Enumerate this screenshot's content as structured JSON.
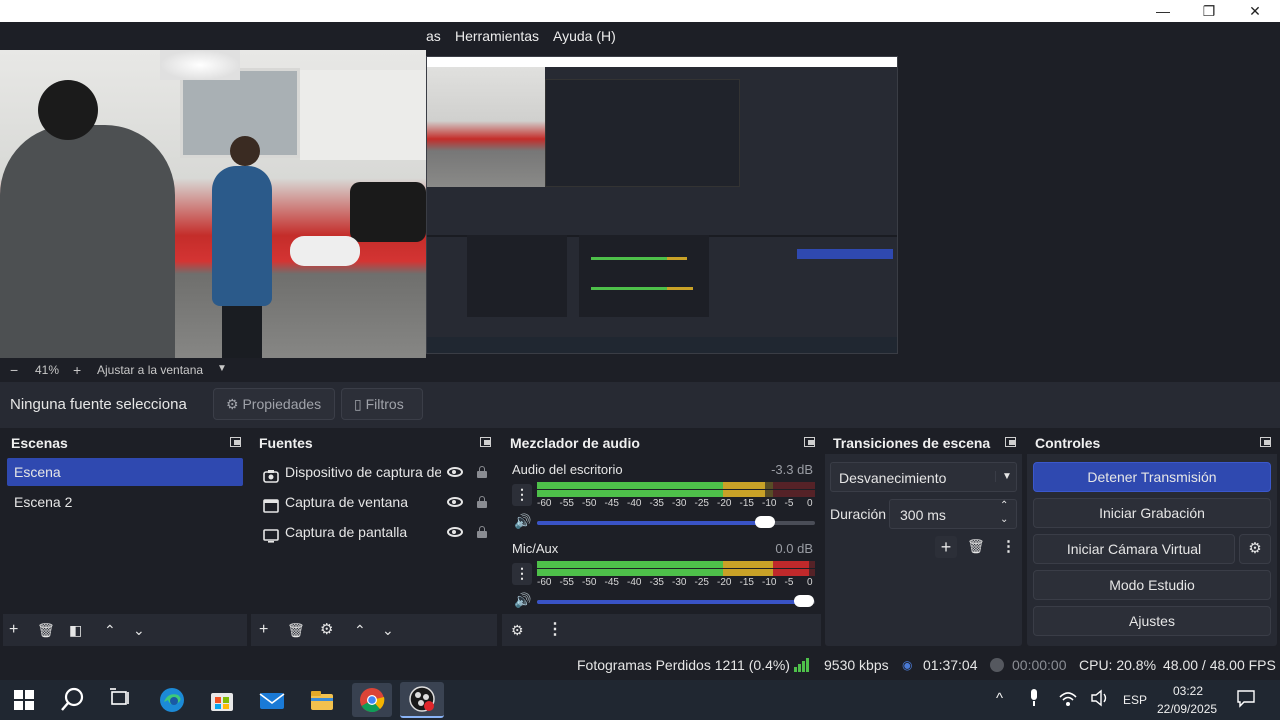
{
  "menu": {
    "items": [
      "as",
      "Herramientas",
      "Ayuda (H)"
    ]
  },
  "window_controls": {
    "minimize": "—",
    "restore": "❐",
    "close": "✕"
  },
  "zoom": {
    "minus": "−",
    "value": "41%",
    "plus": "+",
    "fit_label": "Ajustar a la ventana",
    "dropdown": "▼"
  },
  "properties_bar": {
    "no_source": "Ninguna fuente selecciona",
    "properties_label": "Propiedades",
    "filters_label": "Filtros"
  },
  "scenes": {
    "title": "Escenas",
    "items": [
      "Escena",
      "Escena 2"
    ]
  },
  "sources": {
    "title": "Fuentes",
    "items": [
      "Dispositivo de captura de",
      "Captura de ventana",
      "Captura de pantalla"
    ]
  },
  "mixer": {
    "title": "Mezclador de audio",
    "channels": [
      {
        "name": "Audio del escritorio",
        "db": "-3.3 dB",
        "level_fraction": 0.82,
        "volume_fraction": 0.82
      },
      {
        "name": "Mic/Aux",
        "db": "0.0 dB",
        "level_fraction": 0.98,
        "volume_fraction": 0.96
      }
    ],
    "scale": [
      "-60",
      "-55",
      "-50",
      "-45",
      "-40",
      "-35",
      "-30",
      "-25",
      "-20",
      "-15",
      "-10",
      "-5",
      "0"
    ]
  },
  "transitions": {
    "title": "Transiciones de escena",
    "selected": "Desvanecimiento",
    "duration_label": "Duración",
    "duration_value": "300 ms"
  },
  "controls": {
    "title": "Controles",
    "stop_stream": "Detener Transmisión",
    "start_record": "Iniciar Grabación",
    "start_virtual_cam": "Iniciar Cámara Virtual",
    "studio_mode": "Modo Estudio",
    "settings": "Ajustes"
  },
  "status": {
    "dropped_frames": "Fotogramas Perdidos 1211 (0.4%)",
    "bitrate": "9530 kbps",
    "stream_time": "01:37:04",
    "record_time": "00:00:00",
    "cpu": "CPU: 20.8%",
    "fps": "48.00 / 48.00 FPS"
  },
  "taskbar": {
    "lang": "ESP",
    "time": "03:22",
    "date": "22/09/2025",
    "chevron": "^"
  },
  "colors": {
    "accent": "#2f49b0",
    "meter_green": "#4ec04a",
    "meter_yellow": "#c9a227",
    "meter_red": "#c0292b",
    "bg": "#1d1f26",
    "panel": "#272a33"
  }
}
